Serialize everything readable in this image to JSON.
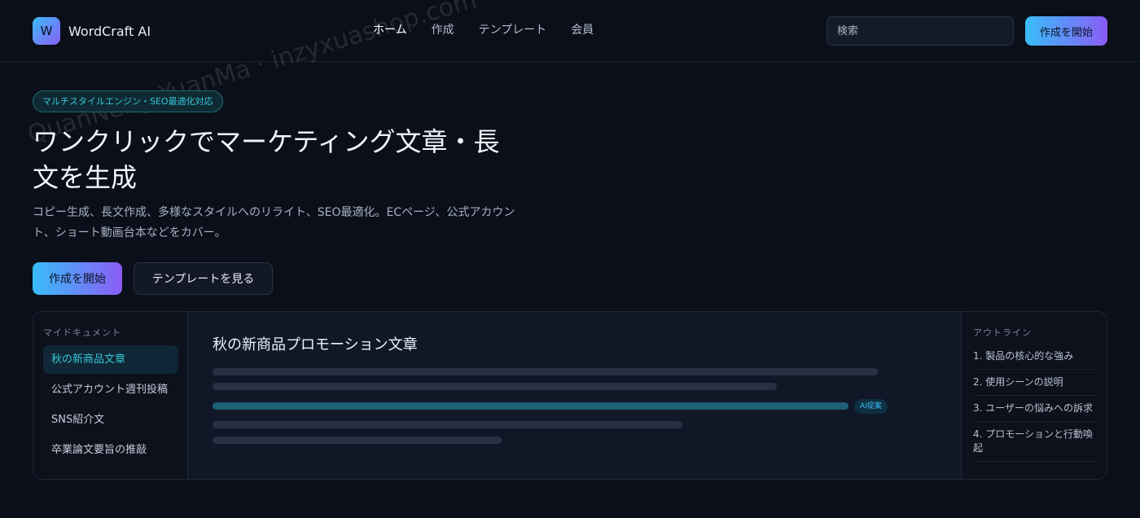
{
  "header": {
    "logo_letter": "W",
    "brand": "WordCraft AI",
    "nav": [
      "ホーム",
      "作成",
      "テンプレート",
      "会員"
    ],
    "search_placeholder": "検索",
    "cta": "作成を開始"
  },
  "watermark": "QuanNeng YuanMa · inzyxuashop.com",
  "hero": {
    "badge": "マルチスタイルエンジン・SEO最適化対応",
    "title": "ワンクリックでマーケティング文章・長文を生成",
    "description": "コピー生成、長文作成、多様なスタイルへのリライト、SEO最適化。ECページ、公式アカウント、ショート動画台本などをカバー。",
    "primary_cta": "作成を開始",
    "secondary_cta": "テンプレートを見る"
  },
  "editor": {
    "documents_heading": "マイドキュメント",
    "documents": [
      "秋の新商品文章",
      "公式アカウント週刊投稿",
      "SNS紹介文",
      "卒業論文要旨の推敲"
    ],
    "active_document": 0,
    "doc_title": "秋の新商品プロモーション文章",
    "ai_tag": "AI提案",
    "outline_heading": "アウトライン",
    "outline": [
      "1. 製品の核心的な強み",
      "2. 使用シーンの説明",
      "3. ユーザーの悩みへの訴求",
      "4. プロモーションと行動喚起"
    ]
  },
  "colors": {
    "background": "#0b0f1a",
    "accent_start": "#38bdf8",
    "accent_end": "#8b5cf6",
    "highlight": "#38c6d9"
  }
}
